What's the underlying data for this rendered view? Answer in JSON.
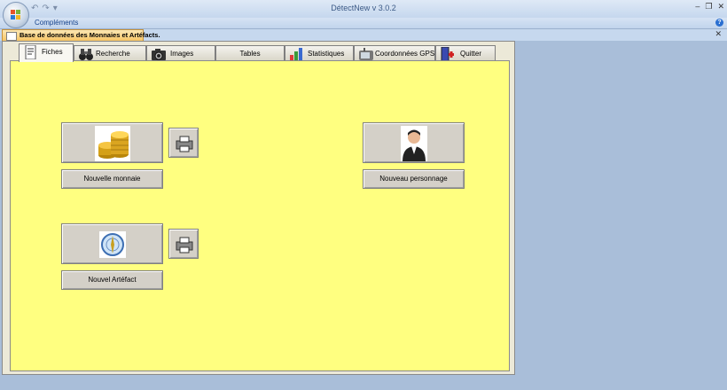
{
  "app": {
    "title": "DétectNew v 3.0.2",
    "ribbon_tab": "Compléments",
    "qat_undo": "↶",
    "qat_redo": "↷",
    "qat_more": "▾"
  },
  "window_controls": {
    "minimize": "–",
    "restore": "❐",
    "close": "✕"
  },
  "document": {
    "tab_label": "Base de données des Monnaies et Artéfacts.",
    "close": "✕"
  },
  "tabs": [
    {
      "label": "Fiches",
      "icon": "document-icon",
      "active": true
    },
    {
      "label": "Recherche",
      "icon": "binoculars-icon"
    },
    {
      "label": "Images",
      "icon": "camera-icon"
    },
    {
      "label": "Tables",
      "icon": ""
    },
    {
      "label": "Statistiques",
      "icon": "bar-chart-icon"
    },
    {
      "label": "Coordonnées GPS",
      "icon": "gps-device-icon"
    },
    {
      "label": "Quitter",
      "icon": "exit-door-icon"
    }
  ],
  "buttons": {
    "new_coin": "Nouvelle monnaie",
    "new_person": "Nouveau personnage",
    "new_artifact": "Nouvel Artéfact"
  },
  "colors": {
    "panel_background": "#ffff80",
    "form_background": "#ece9d8",
    "app_background": "#a9bed9",
    "doc_tab_orange": "#f7c564"
  }
}
